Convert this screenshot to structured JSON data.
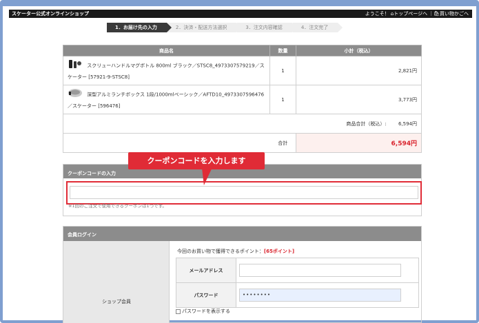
{
  "topbar": {
    "brand": "スケーター公式オンラインショップ",
    "welcome": "ようこそ！",
    "top_link": "⌂トップページへ",
    "cart_link": "｜🛍買い物かごへ"
  },
  "steps": [
    "1．お届け先の入力",
    "2．決済・配送方法選択",
    "3．注文内容確認",
    "4．注文完了"
  ],
  "cart": {
    "headers": {
      "product": "商品名",
      "qty": "数量",
      "subtotal": "小計（税込）"
    },
    "rows": [
      {
        "name": "スクリューハンドルマグボトル 800ml ブラック／STSC8_4973307579219／スケーター [57921-9-STSC8]",
        "qty": "1",
        "subtotal": "2,821円"
      },
      {
        "name": "深型アルミランチボックス 1段/1000mlベーシック／AFTD10_4973307596476／スケーター [596476]",
        "qty": "1",
        "subtotal": "3,773円"
      }
    ],
    "goods_total_label": "商品合計（税込）:",
    "goods_total": "6,594円",
    "grand_label": "合計",
    "grand_total": "6,594円"
  },
  "coupon": {
    "heading": "クーポンコードの入力",
    "input_value": "",
    "note": "※1回のご注文で使用できるクーポンは1つです。",
    "callout": "クーポンコードを入力します"
  },
  "login": {
    "heading": "会員ログイン",
    "left_label": "ショップ会員",
    "points_text": "今回のお買い物で獲得できるポイント：",
    "points_value": "[65ポイント]",
    "email_label": "メールアドレス",
    "email_value": "",
    "password_label": "パスワード",
    "password_value": "••••••••",
    "show_password": "パスワードを表示する"
  },
  "colors": {
    "accent_red": "#e02b36",
    "header_gray": "#8c8c8c",
    "frame_blue": "#7f9fd0"
  }
}
